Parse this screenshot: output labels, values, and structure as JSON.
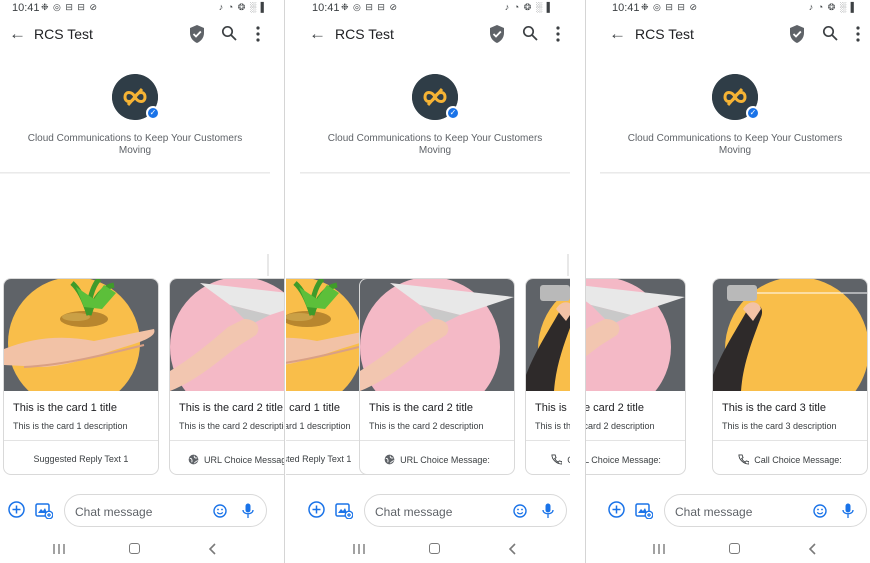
{
  "status_bar": {
    "time": "10:41",
    "notification_icons": "❉ ◎ ⊟ ⊟ ⊘",
    "system_icons": "♪ ◔ ❂ ░ ▌"
  },
  "header": {
    "title": "RCS Test",
    "back_icon": "arrow-back-icon",
    "verified_icon": "verified-shield-icon",
    "search_icon": "search-icon",
    "menu_icon": "more-vert-icon"
  },
  "profile": {
    "tagline": "Cloud Communications to Keep Your Customers Moving",
    "badge_glyph": "✓",
    "brand_color": "#f5b335",
    "logo_bg": "#2f3d47"
  },
  "cards": [
    {
      "title": "This is the card 1 title",
      "description": "This is the card 1 description",
      "action": "Suggested Reply Text 1",
      "action_icon": "",
      "image": "coins-in-hand",
      "circle_color": "#f9be4a"
    },
    {
      "title": "This is the card 2 title",
      "description": "This is the card 2 description",
      "action": "URL Choice Message:",
      "action_icon": "globe-icon",
      "image": "paper-plane-hand",
      "circle_color": "#f4b9c6"
    },
    {
      "title": "This is the card 3 title",
      "description": "This is the card 3 description",
      "action": "Call Choice Message:",
      "action_icon": "phone-icon",
      "image": "tin-can-phone",
      "circle_color": "#f9be4a"
    }
  ],
  "composer": {
    "placeholder": "Chat message"
  },
  "colors": {
    "accent": "#1a73e8",
    "card_media_bg": "#5f6368"
  }
}
